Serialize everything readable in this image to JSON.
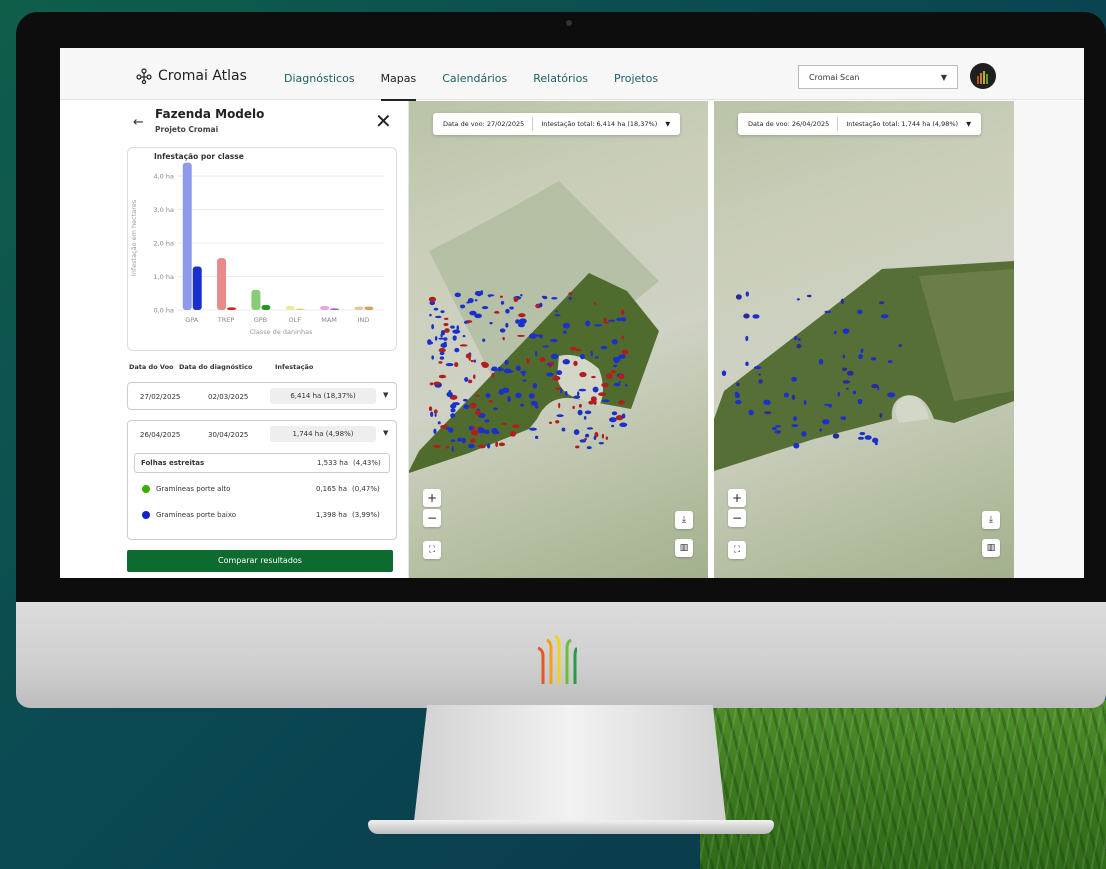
{
  "app": {
    "name": "Cromai Atlas",
    "nav": [
      {
        "label": "Diagnósticos",
        "active": false
      },
      {
        "label": "Mapas",
        "active": true
      },
      {
        "label": "Calendários",
        "active": false
      },
      {
        "label": "Relatórios",
        "active": false
      },
      {
        "label": "Projetos",
        "active": false
      }
    ],
    "product_select": "Cromai Scan"
  },
  "panel": {
    "farm_title": "Fazenda Modelo",
    "project_name": "Projeto Cromai",
    "compare_button": "Comparar resultados",
    "table_headers": {
      "flight_date": "Data do Voo",
      "diagnosis_date": "Data do diagnóstico",
      "infestation": "Infestação"
    },
    "rows": [
      {
        "flight_date": "27/02/2025",
        "diagnosis_date": "02/03/2025",
        "infestation": "6,414 ha (18,37%)"
      },
      {
        "flight_date": "26/04/2025",
        "diagnosis_date": "30/04/2025",
        "infestation": "1,744 ha (4,98%)"
      }
    ],
    "breakdown": {
      "group_label": "Folhas estreitas",
      "group_value": "1,533 ha",
      "group_pct": "(4,43%)",
      "items": [
        {
          "label": "Gramíneas porte alto",
          "value": "0,165 ha",
          "pct": "(0,47%)",
          "color": "#33b000"
        },
        {
          "label": "Gramíneas porte baixo",
          "value": "1,398 ha",
          "pct": "(3,99%)",
          "color": "#1122cc"
        }
      ]
    }
  },
  "chart_data": {
    "type": "bar",
    "title": "Infestação por classe",
    "xlabel": "Classe de daninhas",
    "ylabel": "Infestação em hectares",
    "ylim": [
      0,
      4.3
    ],
    "yticks": [
      "0,0 ha",
      "1,0 ha",
      "2,0 ha",
      "3,0 ha",
      "4,0 ha"
    ],
    "categories": [
      "GPA",
      "TREP",
      "GPB",
      "OLF",
      "MAM",
      "IND"
    ],
    "series": [
      {
        "values": [
          4.4,
          1.55,
          0.6,
          0.12,
          0.12,
          0.1
        ],
        "colors": [
          "#8e9bea",
          "#e88a8a",
          "#88cc77",
          "#e8ec9a",
          "#e4a8e8",
          "#e6c79a"
        ]
      },
      {
        "values": [
          1.3,
          0.08,
          0.15,
          0.04,
          0.05,
          0.1
        ],
        "colors": [
          "#1a2fcc",
          "#cc2222",
          "#239923",
          "#d6d66a",
          "#b455c7",
          "#d9a15a"
        ]
      }
    ],
    "grid": true
  },
  "maps": {
    "left": {
      "label": "Data de voo: 27/02/2025",
      "total": "Intestação total: 6,414 ha (18,37%)"
    },
    "right": {
      "label": "Data de voo: 26/04/2025",
      "total": "Intestação total: 1,744 ha (4,98%)"
    }
  }
}
